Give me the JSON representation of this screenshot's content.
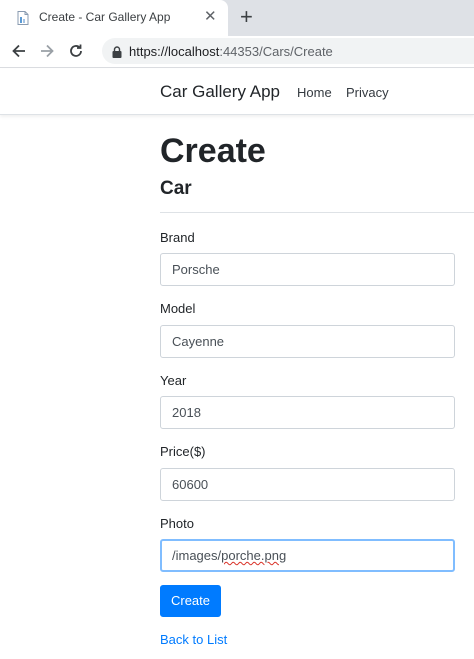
{
  "browser": {
    "tab_title": "Create - Car Gallery App",
    "tab_icons": {
      "favicon": "page-favicon",
      "close": "close-icon",
      "new_tab": "plus-icon"
    },
    "url_host": "https://localhost",
    "url_rest": ":44353/Cars/Create",
    "toolbar_icons": [
      "back-arrow-icon",
      "forward-arrow-icon",
      "reload-icon",
      "lock-icon"
    ]
  },
  "navbar": {
    "brand": "Car Gallery App",
    "links": [
      "Home",
      "Privacy"
    ]
  },
  "page": {
    "heading": "Create",
    "subheading": "Car"
  },
  "form": {
    "fields": [
      {
        "label": "Brand",
        "value": "Porsche"
      },
      {
        "label": "Model",
        "value": "Cayenne"
      },
      {
        "label": "Year",
        "value": "2018"
      },
      {
        "label": "Price($)",
        "value": "60600"
      },
      {
        "label": "Photo",
        "value_prefix": "/images/",
        "value_spell": "porche.png"
      }
    ],
    "submit_label": "Create",
    "back_link": "Back to List"
  },
  "colors": {
    "primary": "#007bff",
    "focus_border": "#80bdff",
    "text": "#212529",
    "input_text": "#495057",
    "tabstrip_bg": "#dee1e6",
    "omnibox_bg": "#f1f3f4"
  }
}
